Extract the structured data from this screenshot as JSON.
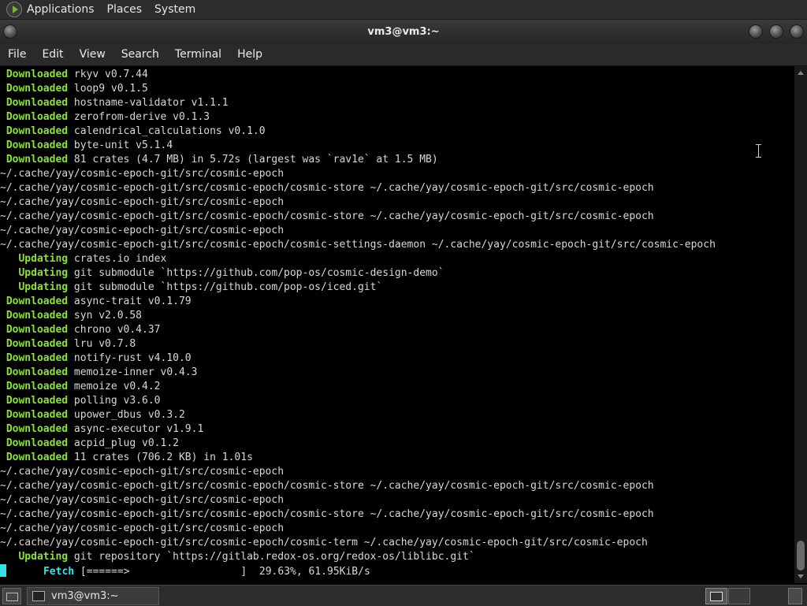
{
  "top_panel": {
    "menus": [
      "Applications",
      "Places",
      "System"
    ]
  },
  "window": {
    "title": "vm3@vm3:~"
  },
  "menubar": {
    "items": [
      "File",
      "Edit",
      "View",
      "Search",
      "Terminal",
      "Help"
    ]
  },
  "terminal": {
    "lines": [
      {
        "label": " Downloaded",
        "text": " rkyv v0.7.44"
      },
      {
        "label": " Downloaded",
        "text": " loop9 v0.1.5"
      },
      {
        "label": " Downloaded",
        "text": " hostname-validator v1.1.1"
      },
      {
        "label": " Downloaded",
        "text": " zerofrom-derive v0.1.3"
      },
      {
        "label": " Downloaded",
        "text": " calendrical_calculations v0.1.0"
      },
      {
        "label": " Downloaded",
        "text": " byte-unit v5.1.4"
      },
      {
        "label": " Downloaded",
        "text": " 81 crates (4.7 MB) in 5.72s (largest was `rav1e` at 1.5 MB)"
      },
      {
        "label": "",
        "text": "~/.cache/yay/cosmic-epoch-git/src/cosmic-epoch"
      },
      {
        "label": "",
        "text": "~/.cache/yay/cosmic-epoch-git/src/cosmic-epoch/cosmic-store ~/.cache/yay/cosmic-epoch-git/src/cosmic-epoch"
      },
      {
        "label": "",
        "text": "~/.cache/yay/cosmic-epoch-git/src/cosmic-epoch"
      },
      {
        "label": "",
        "text": "~/.cache/yay/cosmic-epoch-git/src/cosmic-epoch/cosmic-store ~/.cache/yay/cosmic-epoch-git/src/cosmic-epoch"
      },
      {
        "label": "",
        "text": "~/.cache/yay/cosmic-epoch-git/src/cosmic-epoch"
      },
      {
        "label": "",
        "text": "~/.cache/yay/cosmic-epoch-git/src/cosmic-epoch/cosmic-settings-daemon ~/.cache/yay/cosmic-epoch-git/src/cosmic-epoch"
      },
      {
        "label": "   Updating",
        "text": " crates.io index"
      },
      {
        "label": "   Updating",
        "text": " git submodule `https://github.com/pop-os/cosmic-design-demo`"
      },
      {
        "label": "   Updating",
        "text": " git submodule `https://github.com/pop-os/iced.git`"
      },
      {
        "label": " Downloaded",
        "text": " async-trait v0.1.79"
      },
      {
        "label": " Downloaded",
        "text": " syn v2.0.58"
      },
      {
        "label": " Downloaded",
        "text": " chrono v0.4.37"
      },
      {
        "label": " Downloaded",
        "text": " lru v0.7.8"
      },
      {
        "label": " Downloaded",
        "text": " notify-rust v4.10.0"
      },
      {
        "label": " Downloaded",
        "text": " memoize-inner v0.4.3"
      },
      {
        "label": " Downloaded",
        "text": " memoize v0.4.2"
      },
      {
        "label": " Downloaded",
        "text": " polling v3.6.0"
      },
      {
        "label": " Downloaded",
        "text": " upower_dbus v0.3.2"
      },
      {
        "label": " Downloaded",
        "text": " async-executor v1.9.1"
      },
      {
        "label": " Downloaded",
        "text": " acpid_plug v0.1.2"
      },
      {
        "label": " Downloaded",
        "text": " 11 crates (706.2 KB) in 1.01s"
      },
      {
        "label": "",
        "text": "~/.cache/yay/cosmic-epoch-git/src/cosmic-epoch"
      },
      {
        "label": "",
        "text": "~/.cache/yay/cosmic-epoch-git/src/cosmic-epoch/cosmic-store ~/.cache/yay/cosmic-epoch-git/src/cosmic-epoch"
      },
      {
        "label": "",
        "text": "~/.cache/yay/cosmic-epoch-git/src/cosmic-epoch"
      },
      {
        "label": "",
        "text": "~/.cache/yay/cosmic-epoch-git/src/cosmic-epoch/cosmic-store ~/.cache/yay/cosmic-epoch-git/src/cosmic-epoch"
      },
      {
        "label": "",
        "text": "~/.cache/yay/cosmic-epoch-git/src/cosmic-epoch"
      },
      {
        "label": "",
        "text": "~/.cache/yay/cosmic-epoch-git/src/cosmic-epoch/cosmic-term ~/.cache/yay/cosmic-epoch-git/src/cosmic-epoch"
      },
      {
        "label": "   Updating",
        "text": " git repository `https://gitlab.redox-os.org/redox-os/liblibc.git`"
      }
    ],
    "fetch_line": {
      "label": "      Fetch",
      "text": " [======>                  ]  29.63%, 61.95KiB/s"
    },
    "colors": {
      "label_green": "#8ae234",
      "label_cyan": "#34e2e2",
      "text": "#d8d8d8",
      "background": "#000000"
    }
  },
  "taskbar": {
    "task_label": "vm3@vm3:~"
  }
}
